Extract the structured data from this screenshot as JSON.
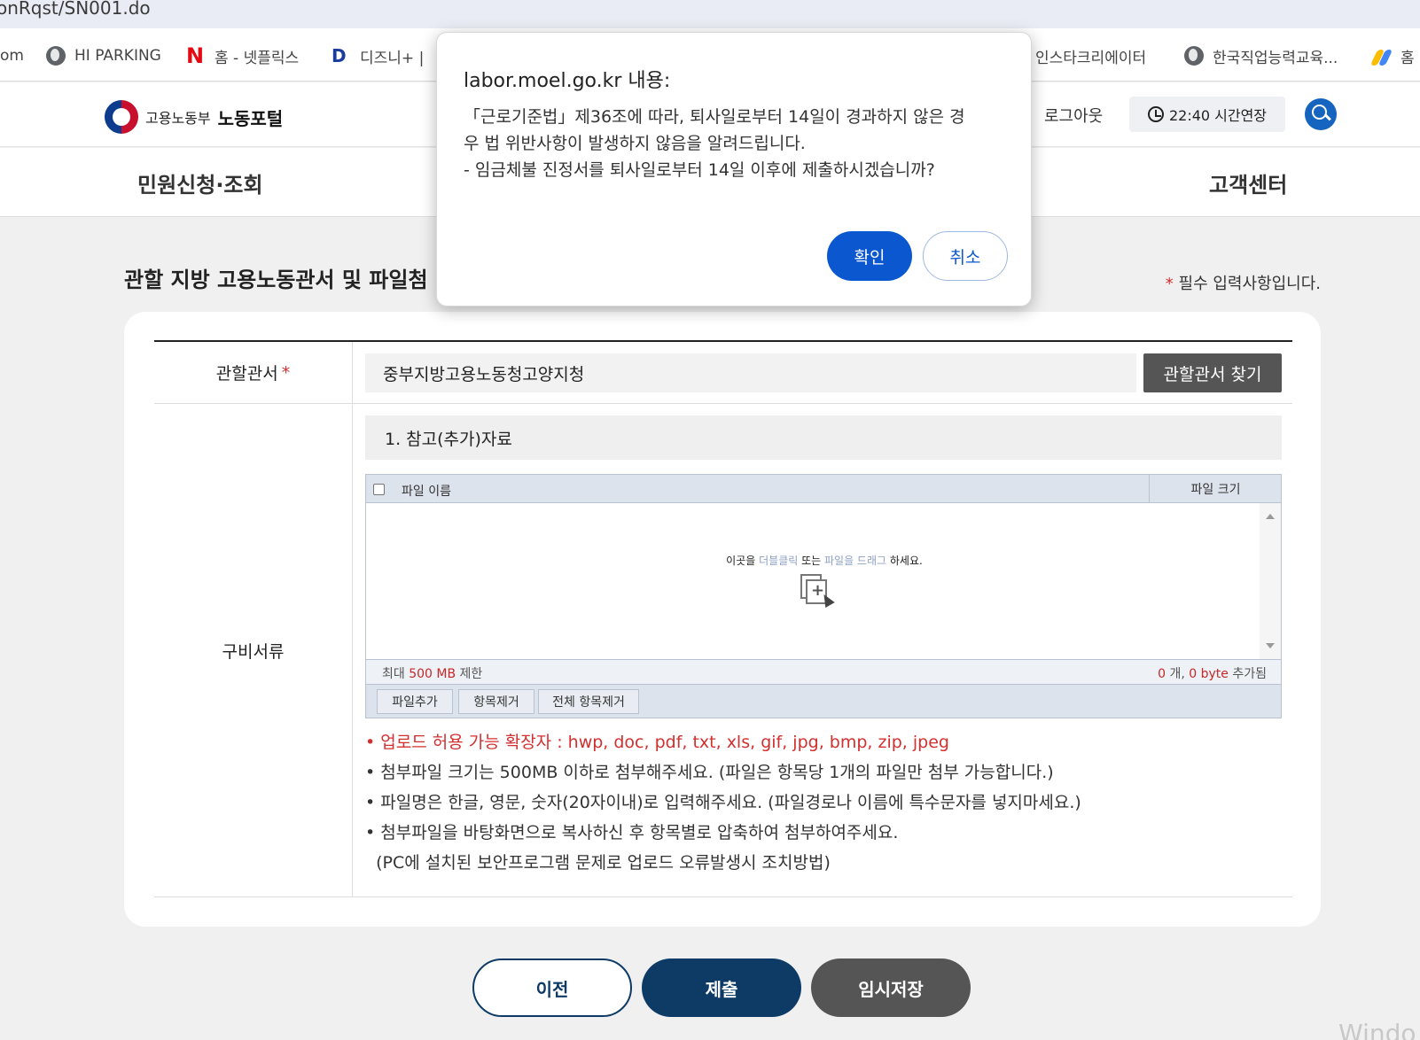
{
  "browser": {
    "url_fragment": "onRqst/SN001.do",
    "bookmarks": [
      {
        "label": "om",
        "icon": "none"
      },
      {
        "label": "HI PARKING",
        "icon": "globe-icon"
      },
      {
        "label": "홈 - 넷플릭스",
        "icon": "netflix-icon"
      },
      {
        "label": "디즈니+ |",
        "icon": "disney-icon"
      },
      {
        "label": "인스타크리에이터",
        "icon": "none"
      },
      {
        "label": "한국직업능력교육...",
        "icon": "globe-icon"
      },
      {
        "label": "홈",
        "icon": "google-ads-icon"
      }
    ],
    "netflix_glyph": "N",
    "disney_glyph": "D"
  },
  "header": {
    "org": "고용노동부",
    "portal": "노동포털",
    "logout": "로그아웃",
    "time_extend": "22:40 시간연장"
  },
  "nav": {
    "left": "민원신청·조회",
    "right": "고객센터"
  },
  "page": {
    "section_title": "관할 지방 고용노동관서 및 파일첨",
    "required_star": "*",
    "required_note": " 필수 입력사항입니다."
  },
  "form": {
    "office_label": "관할관서",
    "office_star": "*",
    "office_value": "중부지방고용노동청고양지청",
    "find_office_button": "관할관서 찾기",
    "docs_label": "구비서류",
    "ref_title": "1. 참고(추가)자료"
  },
  "uploader": {
    "col_name": "파일 이름",
    "col_size": "파일 크기",
    "drop_prefix": "이곳을 ",
    "drop_dbl": "더블클릭",
    "drop_or": " 또는 ",
    "drop_drag": "파일을 드래그",
    "drop_suffix": " 하세요.",
    "limit_prefix": "최대 ",
    "limit_value": "500 MB",
    "limit_suffix": " 제한",
    "count_files": "0",
    "count_mid": " 개, ",
    "count_bytes": "0 byte",
    "count_suffix": " 추가됨",
    "btn_add": "파일추가",
    "btn_remove": "항목제거",
    "btn_remove_all": "전체 항목제거"
  },
  "notes": [
    "• 업로드 허용 가능 확장자 : hwp, doc, pdf, txt, xls, gif, jpg, bmp, zip, jpeg",
    "• 첨부파일 크기는 500MB 이하로 첨부해주세요. (파일은 항목당 1개의 파일만 첨부 가능합니다.)",
    "• 파일명은 한글, 영문, 숫자(20자이내)로 입력해주세요. (파일경로나 이름에 특수문자를 넣지마세요.)",
    "• 첨부파일을 바탕화면으로 복사하신 후 항목별로 압축하여 첨부하여주세요.",
    "  (PC에 설치된 보안프로그램 문제로 업로드 오류발생시 조치방법)"
  ],
  "actions": {
    "prev": "이전",
    "submit": "제출",
    "temp_save": "임시저장"
  },
  "watermark": "Windo",
  "dialog": {
    "title": "labor.moel.go.kr 내용:",
    "line1": "「근로기준법」제36조에 따라, 퇴사일로부터 14일이 경과하지 않은 경",
    "line2": "우 법 위반사항이 발생하지 않음을 알려드립니다.",
    "line3": "- 임금체불 진정서를 퇴사일로부터 14일 이후에 제출하시겠습니까?",
    "ok": "확인",
    "cancel": "취소"
  },
  "colors": {
    "primary_navy": "#0d3b66",
    "dialog_blue": "#0b57d0",
    "required_red": "#d32f2f"
  }
}
